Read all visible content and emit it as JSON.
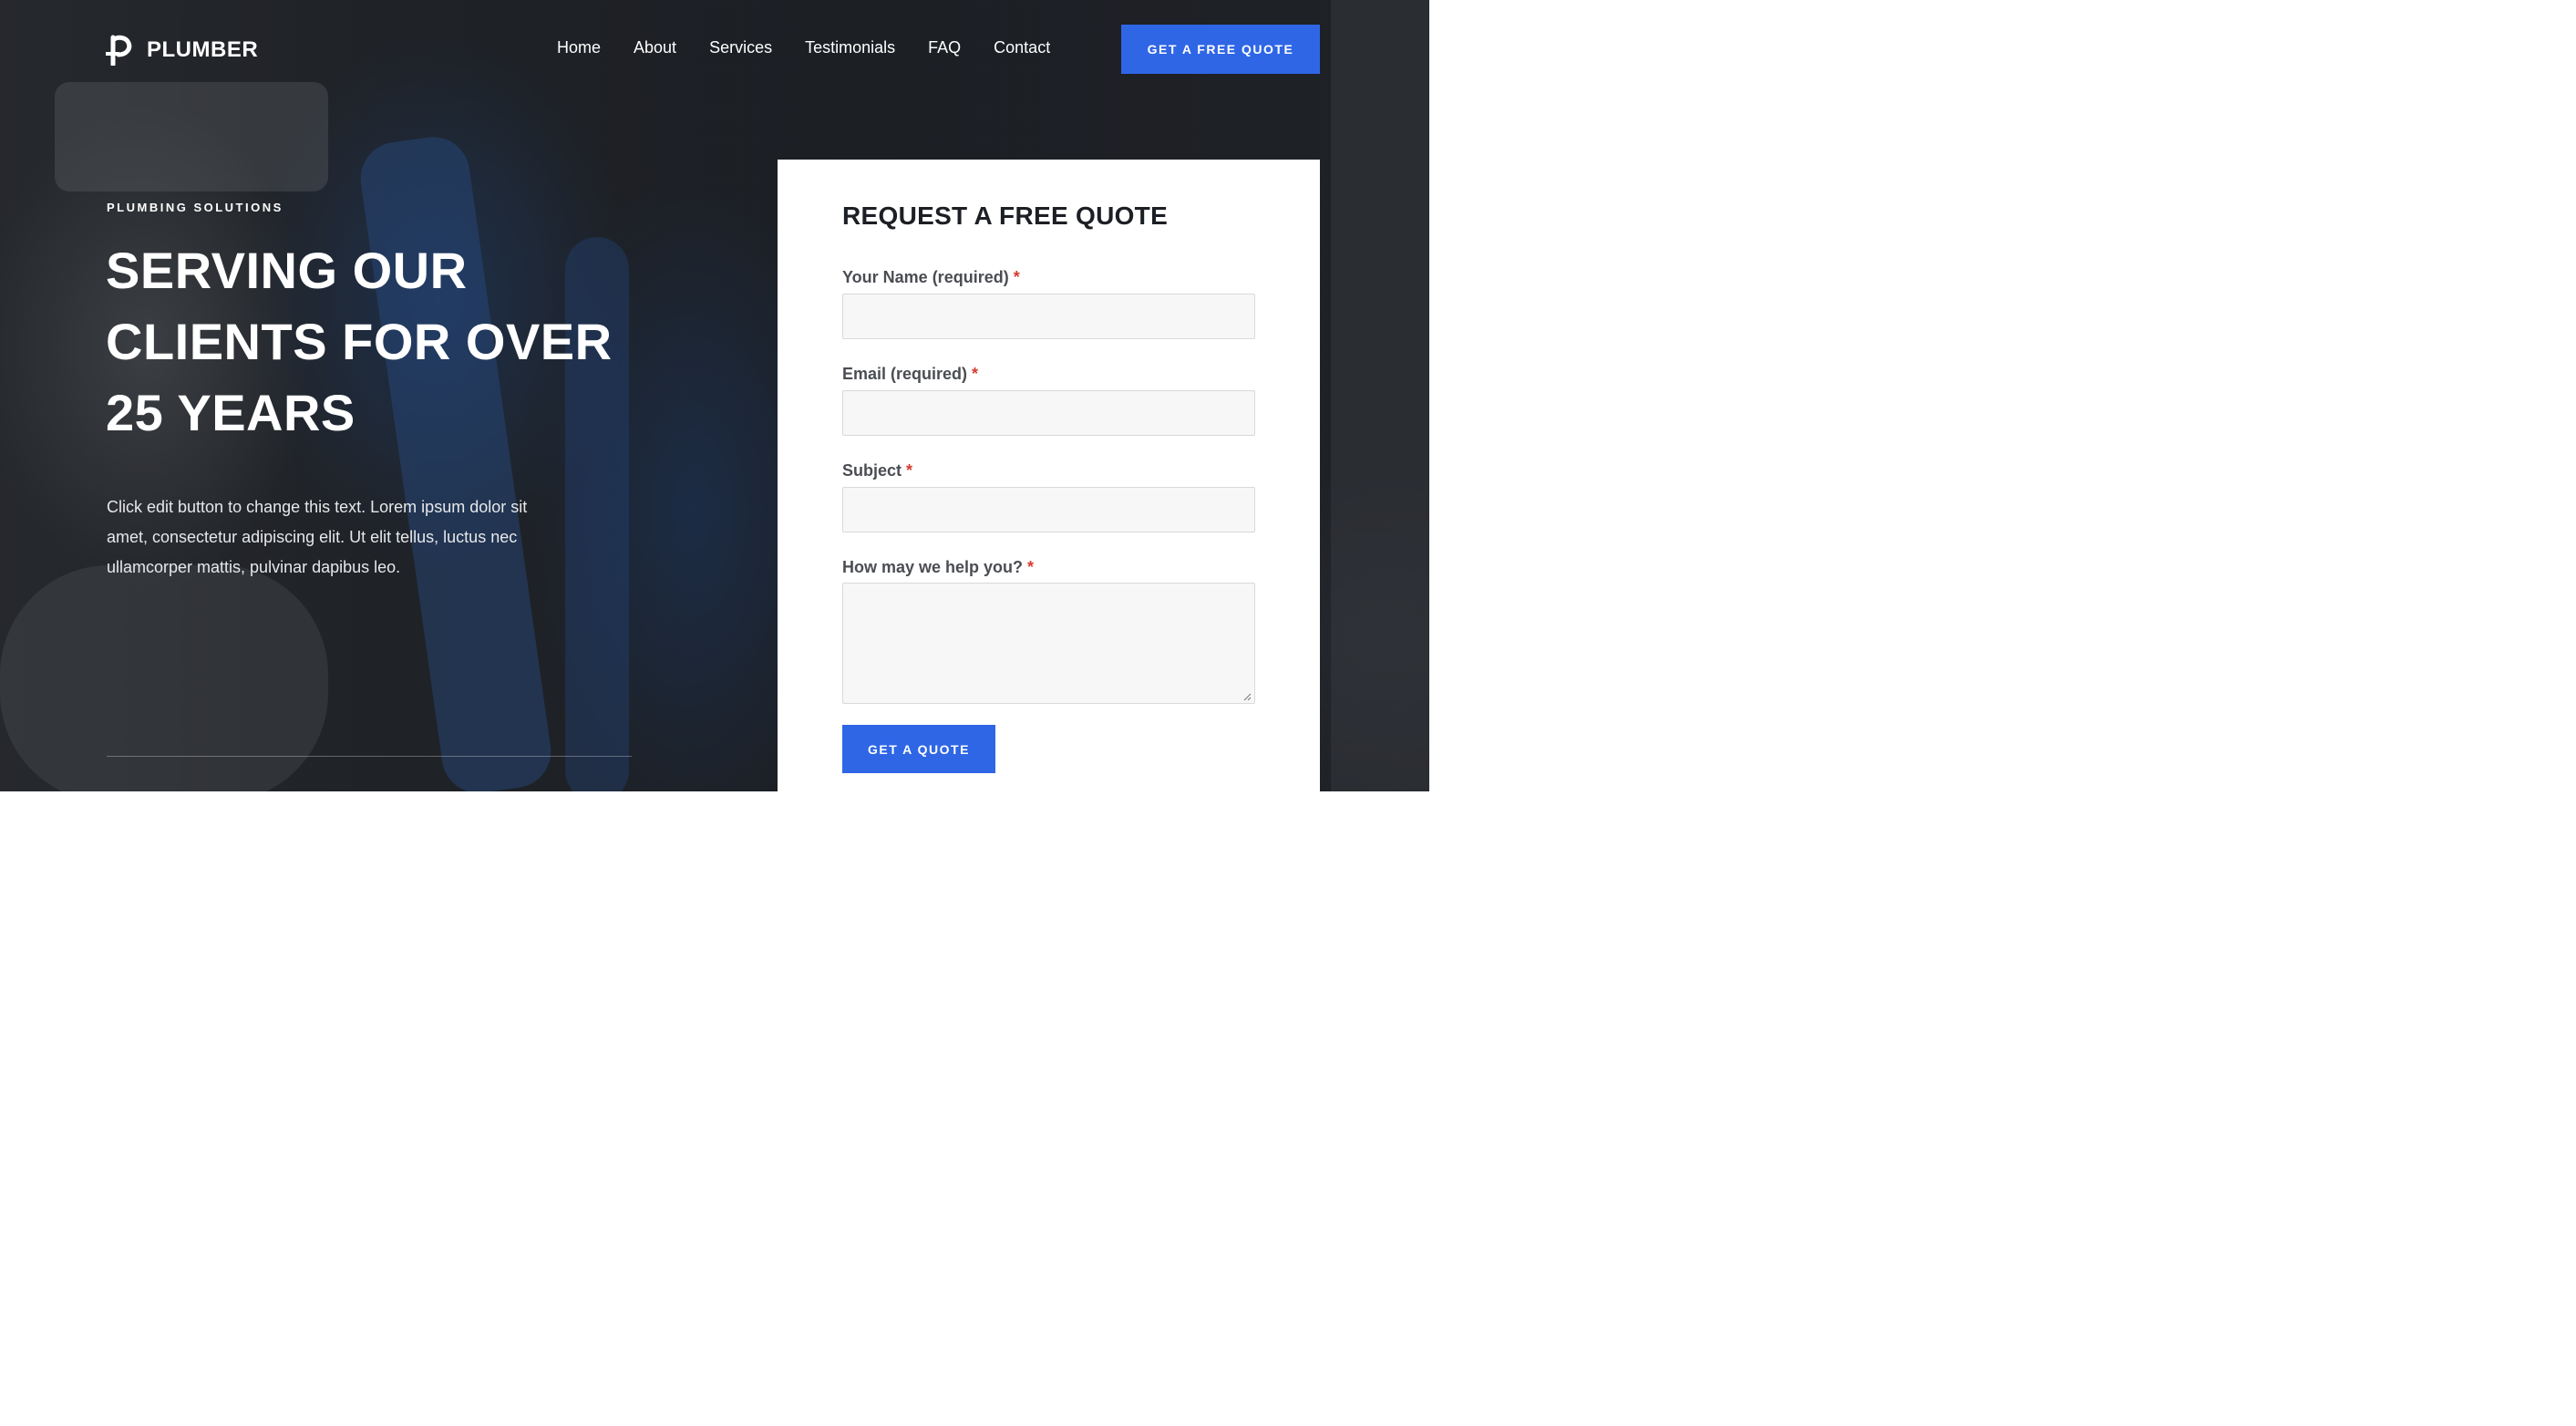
{
  "brand": {
    "name": "PLUMBER",
    "logo_icon": "pipe-p-logo-icon"
  },
  "nav": {
    "items": [
      "Home",
      "About",
      "Services",
      "Testimonials",
      "FAQ",
      "Contact"
    ],
    "cta_label": "GET A FREE QUOTE"
  },
  "hero": {
    "eyebrow": "PLUMBING SOLUTIONS",
    "headline_lines": [
      "SERVING OUR",
      "CLIENTS FOR OVER",
      "25 YEARS"
    ],
    "lead_lines": [
      "Click edit button to change this text. Lorem ipsum dolor sit",
      "amet, consectetur adipiscing elit. Ut elit tellus, luctus nec",
      "ullamcorper mattis, pulvinar dapibus leo."
    ]
  },
  "form": {
    "title": "REQUEST A FREE QUOTE",
    "fields": [
      {
        "label": "Your Name (required)",
        "required_mark": "*",
        "value": "",
        "placeholder": ""
      },
      {
        "label": "Email (required)",
        "required_mark": "*",
        "value": "",
        "placeholder": ""
      },
      {
        "label": "Subject",
        "required_mark": "*",
        "value": "",
        "placeholder": ""
      },
      {
        "label": "How may we help you?",
        "required_mark": "*",
        "value": "",
        "placeholder": ""
      }
    ],
    "submit_label": "GET A QUOTE"
  },
  "colors": {
    "accent": "#2f66e6",
    "required": "#d63b2f",
    "overlay": "#14161a"
  }
}
